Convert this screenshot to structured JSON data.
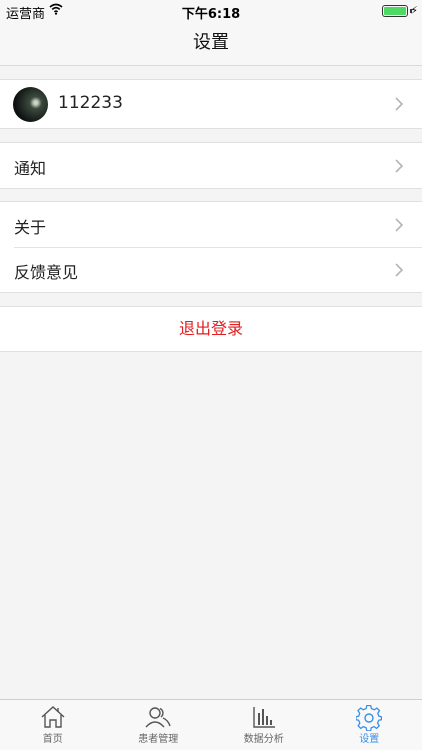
{
  "status_bar": {
    "carrier": "运营商",
    "time": "下午6:18"
  },
  "nav": {
    "title": "设置"
  },
  "profile": {
    "username": "112233"
  },
  "settings": {
    "notifications": "通知",
    "about": "关于",
    "feedback": "反馈意见",
    "logout": "退出登录"
  },
  "tabs": [
    {
      "label": "首页",
      "icon": "home-icon"
    },
    {
      "label": "患者管理",
      "icon": "patients-icon"
    },
    {
      "label": "数据分析",
      "icon": "chart-icon"
    },
    {
      "label": "设置",
      "icon": "gear-icon"
    }
  ],
  "colors": {
    "accent": "#3a8ee6",
    "danger": "#e02020"
  }
}
